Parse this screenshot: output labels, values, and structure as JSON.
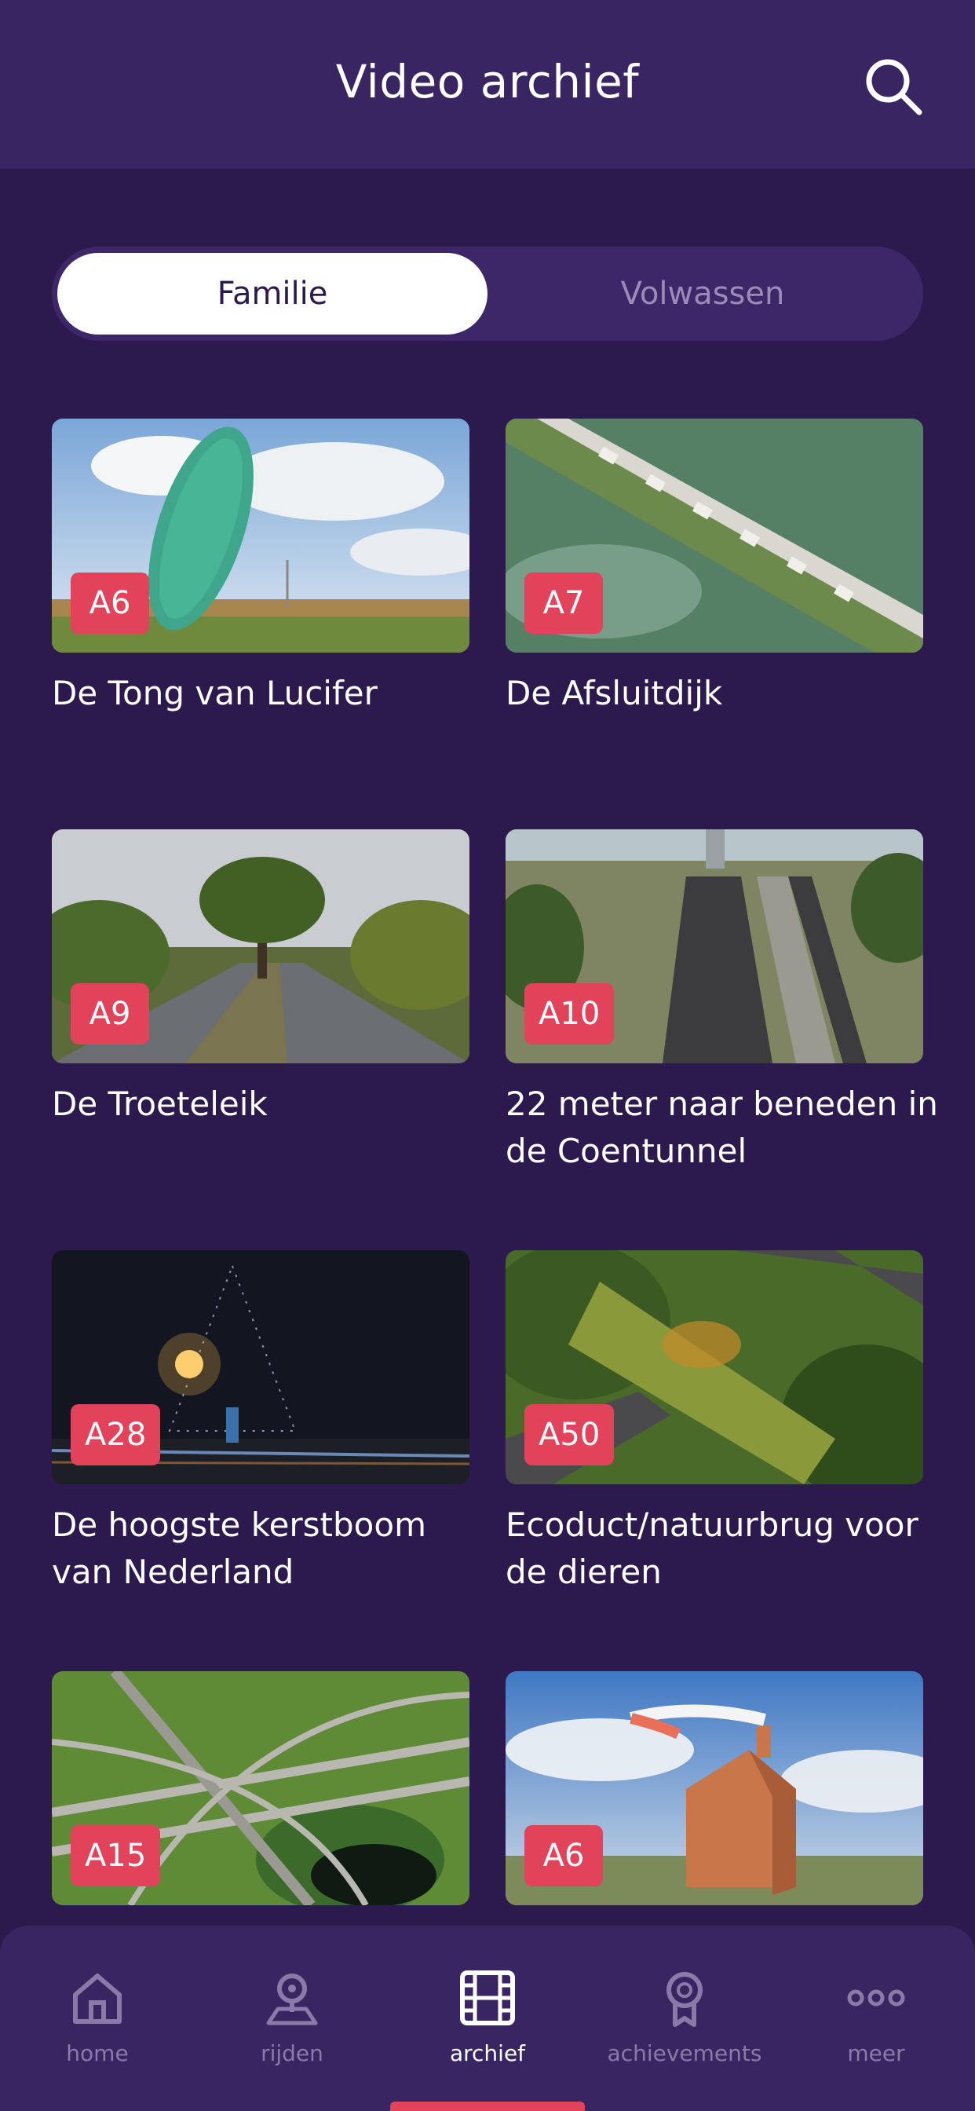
{
  "header": {
    "title": "Video archief"
  },
  "tabs": {
    "active": "Familie",
    "inactive": "Volwassen"
  },
  "videos": [
    {
      "badge": "A6",
      "title": "De Tong van Lucifer"
    },
    {
      "badge": "A7",
      "title": "De Afsluitdijk"
    },
    {
      "badge": "A9",
      "title": "De Troeteleik"
    },
    {
      "badge": "A10",
      "title": "22 meter naar beneden in de Coentunnel"
    },
    {
      "badge": "A28",
      "title": "De hoogste kerstboom van Nederland"
    },
    {
      "badge": "A50",
      "title": "Ecoduct/natuurbrug voor de dieren"
    },
    {
      "badge": "A15",
      "title": ""
    },
    {
      "badge": "A6",
      "title": ""
    }
  ],
  "nav": {
    "home": "home",
    "rijden": "rijden",
    "archief": "archief",
    "achievements": "achievements",
    "meer": "meer"
  },
  "colors": {
    "background": "#2c1a4e",
    "header": "#3a2563",
    "accent": "#e2425a"
  }
}
